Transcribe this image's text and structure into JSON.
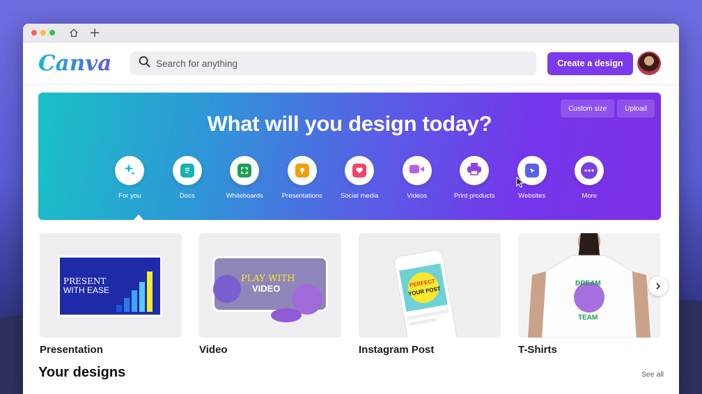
{
  "app": {
    "logo": "Canva"
  },
  "search": {
    "placeholder": "Search for anything"
  },
  "header": {
    "create_label": "Create a design"
  },
  "hero": {
    "title": "What will you design today?",
    "custom_size": "Custom size",
    "upload": "Upload",
    "categories": [
      {
        "label": "For you",
        "icon": "sparkle-icon",
        "color": "#1fb3d9"
      },
      {
        "label": "Docs",
        "icon": "doc-icon",
        "color": "#13b3b5"
      },
      {
        "label": "Whiteboards",
        "icon": "whiteboard-icon",
        "color": "#1e9e57"
      },
      {
        "label": "Presentations",
        "icon": "presentation-icon",
        "color": "#f59e0b"
      },
      {
        "label": "Social media",
        "icon": "heart-icon",
        "color": "#ef4466"
      },
      {
        "label": "Videos",
        "icon": "video-icon",
        "color": "#b660e8"
      },
      {
        "label": "Print products",
        "icon": "printer-icon",
        "color": "#8b45e6"
      },
      {
        "label": "Websites",
        "icon": "cursor-window-icon",
        "color": "#5b5fe6"
      },
      {
        "label": "More",
        "icon": "more-icon",
        "color": "#7a3fe4"
      }
    ]
  },
  "templates": [
    {
      "label": "Presentation",
      "art_line1": "PRESENT",
      "art_line2": "WITH EASE"
    },
    {
      "label": "Video",
      "art_line1": "PLAY WITH",
      "art_line2": "VIDEO"
    },
    {
      "label": "Instagram Post",
      "art_line1": "PERFECT",
      "art_line2": "YOUR POST"
    },
    {
      "label": "T-Shirts",
      "art_line1": "DREAM",
      "art_line2": "TEAM"
    }
  ],
  "your_designs": {
    "title": "Your designs",
    "see_all": "See all"
  },
  "colors": {
    "accent": "#7c3aed"
  }
}
